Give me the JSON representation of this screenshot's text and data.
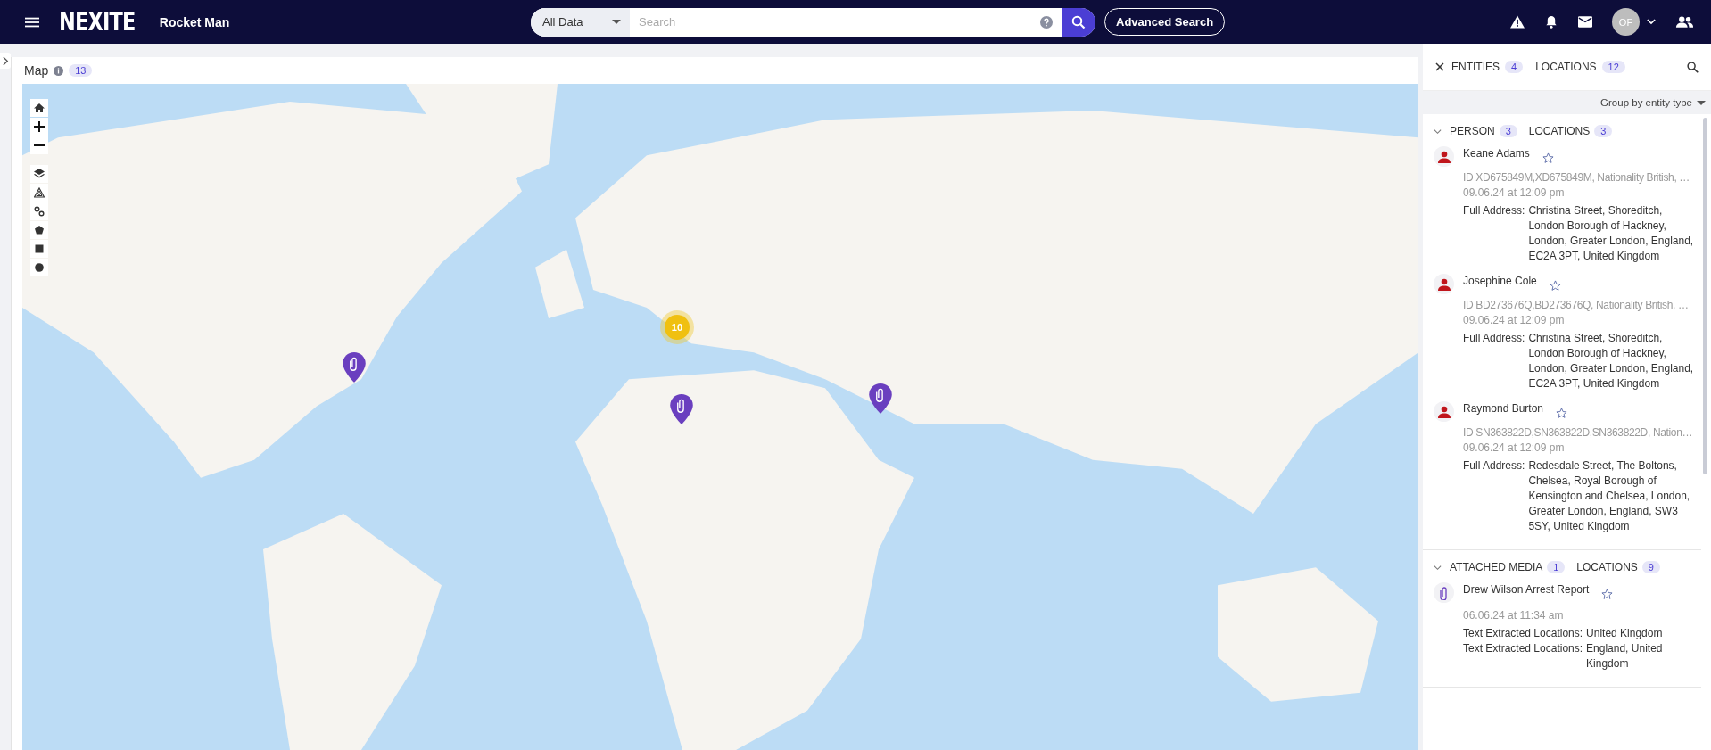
{
  "topbar": {
    "logo": "NEXITE",
    "title": "Rocket Man",
    "scope": "All Data",
    "search": {
      "placeholder": "Search"
    },
    "advanced_button": "Advanced Search",
    "avatar": "OF"
  },
  "map": {
    "title": "Map",
    "count": "13",
    "markers": [
      {
        "kind": "cluster",
        "label": "10"
      },
      {
        "kind": "pin"
      },
      {
        "kind": "pin"
      },
      {
        "kind": "pin"
      }
    ]
  },
  "panel": {
    "tabs": [
      {
        "label": "ENTITIES",
        "count": "4"
      },
      {
        "label": "LOCATIONS",
        "count": "12"
      }
    ],
    "group_by": "Group by entity type",
    "groups": [
      {
        "title": "PERSON",
        "count": "3",
        "locations_label": "LOCATIONS",
        "locations_count": "3",
        "expanded": true,
        "items": [
          {
            "kind": "person",
            "name": "Keane Adams",
            "starred": false,
            "details": "ID XD675849M,XD675849M, Nationality British, …",
            "date": "09.06.24 at 12:09 pm",
            "fields": [
              {
                "label": "Full Address:",
                "value": "Christina Street, Shoreditch, London Borough of Hackney, London, Greater London, England, EC2A 3PT, United Kingdom"
              }
            ]
          },
          {
            "kind": "person",
            "name": "Josephine Cole",
            "starred": false,
            "details": "ID BD273676Q,BD273676Q, Nationality British, …",
            "date": "09.06.24 at 12:09 pm",
            "fields": [
              {
                "label": "Full Address:",
                "value": "Christina Street, Shoreditch, London Borough of Hackney, London, Greater London, England, EC2A 3PT, United Kingdom"
              }
            ]
          },
          {
            "kind": "person",
            "name": "Raymond Burton",
            "starred": false,
            "details": "ID SN363822D,SN363822D,SN363822D, Nation…",
            "date": "09.06.24 at 12:09 pm",
            "fields": [
              {
                "label": "Full Address:",
                "value": "Redesdale Street, The Boltons, Chelsea, Royal Borough of Kensington and Chelsea, London, Greater London, England, SW3 5SY, United Kingdom"
              }
            ]
          }
        ]
      },
      {
        "title": "ATTACHED MEDIA",
        "count": "1",
        "locations_label": "LOCATIONS",
        "locations_count": "9",
        "expanded": true,
        "items": [
          {
            "kind": "media",
            "name": "Drew Wilson Arrest Report",
            "starred": false,
            "date": "06.06.24 at 11:34 am",
            "fields": [
              {
                "label": "Text Extracted Locations:",
                "value": "United Kingdom"
              },
              {
                "label": "Text Extracted Locations:",
                "value": "England, United Kingdom"
              }
            ]
          }
        ]
      }
    ]
  }
}
